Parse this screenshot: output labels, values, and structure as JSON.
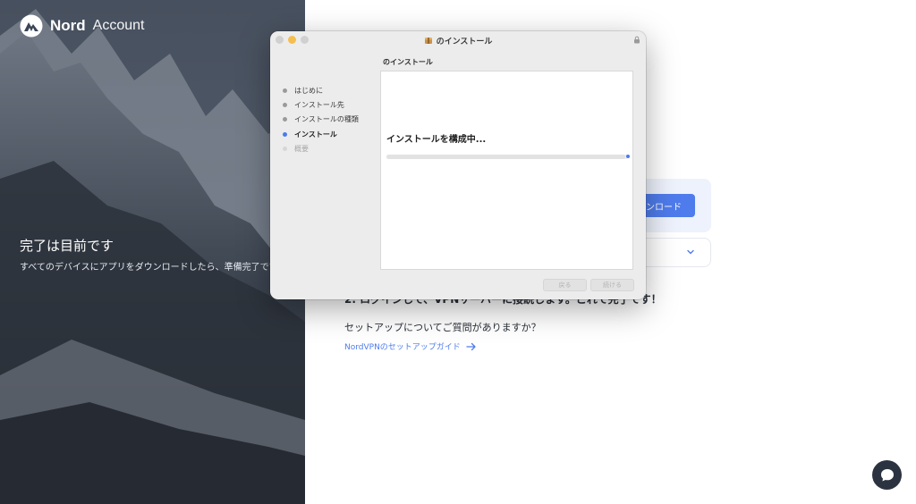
{
  "brand": {
    "name": "Nord",
    "product": "Account"
  },
  "hero": {
    "title": "完了は目前です",
    "subtitle": "すべてのデバイスにアプリをダウンロードしたら、準備完了です。"
  },
  "main": {
    "download_label": "ンロード",
    "step2_text": "2. ログインして、VPNサーバーに接続します。これで完了です！",
    "question": "セットアップについてご質問がありますか？",
    "guide_link": "NordVPNのセットアップガイド"
  },
  "installer": {
    "window_title": "のインストール",
    "pane_title": "のインストール",
    "steps": [
      {
        "label": "はじめに",
        "state": "done"
      },
      {
        "label": "インストール先",
        "state": "done"
      },
      {
        "label": "インストールの種類",
        "state": "done"
      },
      {
        "label": "インストール",
        "state": "active"
      },
      {
        "label": "概要",
        "state": "pending"
      }
    ],
    "status": "インストールを構成中...",
    "progress": 0.99,
    "back_label": "戻る",
    "continue_label": "続ける"
  },
  "colors": {
    "accent": "#4f7cec",
    "step_active": "#4b7bec",
    "traffic_min": "#f5be4f"
  },
  "icons": [
    "nord-logo-icon",
    "chevron-down-icon",
    "arrow-right-icon",
    "chat-icon",
    "lock-icon",
    "installer-package-icon"
  ]
}
